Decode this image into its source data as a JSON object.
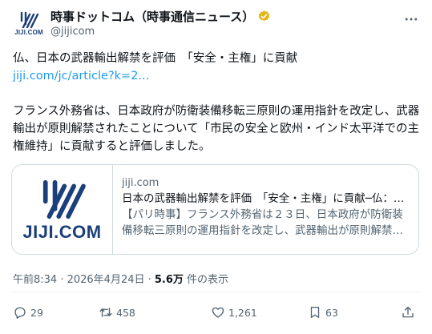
{
  "author": {
    "display_name": "時事ドットコム（時事通信ニュース）",
    "handle": "@jijicom",
    "avatar_wordmark": "JIJI.COM"
  },
  "tweet": {
    "line1": "仏、日本の武器輸出解禁を評価　「安全・主権」に貢献",
    "link": "jiji.com/jc/article?k=2...",
    "paragraph": "フランス外務省は、日本政府が防衛装備移転三原則の運用指針を改定し、武器輸出が原則解禁されたことについて「市民の安全と欧州・インド太平洋での主権維持」に貢献すると評価しました。"
  },
  "card": {
    "thumb_wordmark": "JIJI.COM",
    "domain": "jiji.com",
    "title": "日本の武器輸出解禁を評価　「安全・主権」に貢献─仏：…",
    "description": "【パリ時事】フランス外務省は２３日、日本政府が防衛装備移転三原則の運用指針を改定し、武器輸出が原則解禁され…"
  },
  "meta": {
    "timestamp": "午前8:34 · 2026年4月24日 · ",
    "views": "5.6万",
    "views_suffix": " 件の表示"
  },
  "actions": {
    "replies": "29",
    "reposts": "458",
    "likes": "1,261",
    "bookmarks": "63"
  },
  "colors": {
    "brand": "#1b3f7a",
    "link": "#1d9bf0",
    "muted": "#536471",
    "verified": "#e2b719"
  },
  "icons": [
    "more-icon",
    "verified-badge-icon",
    "reply-icon",
    "repost-icon",
    "like-icon",
    "bookmark-icon",
    "share-icon"
  ]
}
